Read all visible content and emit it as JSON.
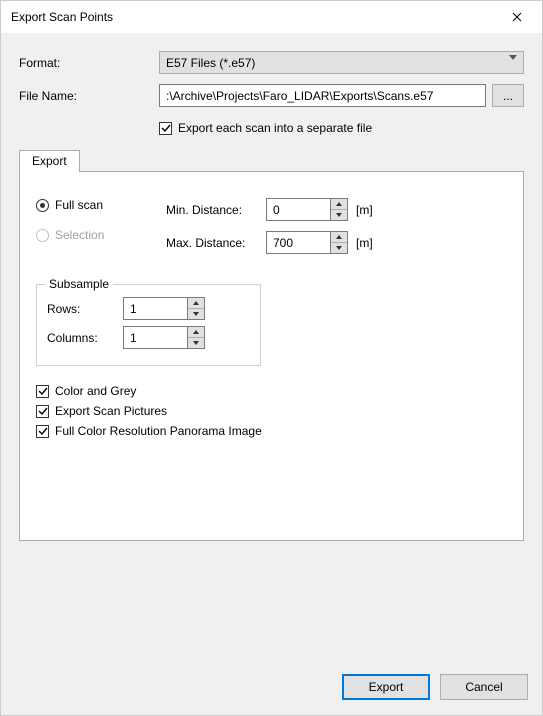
{
  "title": "Export Scan Points",
  "format_label": "Format:",
  "format_value": "E57 Files (*.e57)",
  "filename_label": "File Name:",
  "filename_value": ":\\Archive\\Projects\\Faro_LIDAR\\Exports\\Scans.e57",
  "browse_label": "...",
  "separate_file_label": "Export each scan into a separate file",
  "separate_file_checked": true,
  "tab_label": "Export",
  "radio_full": "Full scan",
  "radio_selection": "Selection",
  "min_dist_label": "Min. Distance:",
  "min_dist_value": "0",
  "max_dist_label": "Max. Distance:",
  "max_dist_value": "700",
  "unit_m": "[m]",
  "subsample_legend": "Subsample",
  "rows_label": "Rows:",
  "rows_value": "1",
  "cols_label": "Columns:",
  "cols_value": "1",
  "chk_color_grey": "Color and Grey",
  "chk_pictures": "Export Scan Pictures",
  "chk_panorama": "Full Color Resolution Panorama Image",
  "export_btn": "Export",
  "cancel_btn": "Cancel"
}
